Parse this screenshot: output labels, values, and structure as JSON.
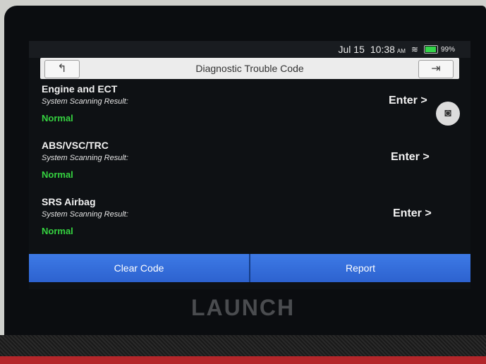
{
  "status": {
    "date": "Jul 15",
    "time": "10:38",
    "ampm": "AM",
    "battery_level": "99%",
    "wifi_icon": "wifi-icon",
    "battery_icon": "battery-icon"
  },
  "header": {
    "title": "Diagnostic Trouble Code",
    "back_icon": "back-icon",
    "exit_icon": "exit-icon"
  },
  "systems": [
    {
      "name": "Engine and ECT",
      "result_label": "System Scanning Result:",
      "status": "Normal",
      "action": "Enter >"
    },
    {
      "name": "ABS/VSC/TRC",
      "result_label": "System Scanning Result:",
      "status": "Normal",
      "action": "Enter >"
    },
    {
      "name": "SRS Airbag",
      "result_label": "System Scanning Result:",
      "status": "Normal",
      "action": "Enter >"
    }
  ],
  "camera_icon": "camera-icon",
  "buttons": {
    "clear_code": "Clear Code",
    "report": "Report"
  },
  "brand": "LAUNCH",
  "colors": {
    "status_normal": "#35d240",
    "button_blue": "#2f67d8"
  }
}
